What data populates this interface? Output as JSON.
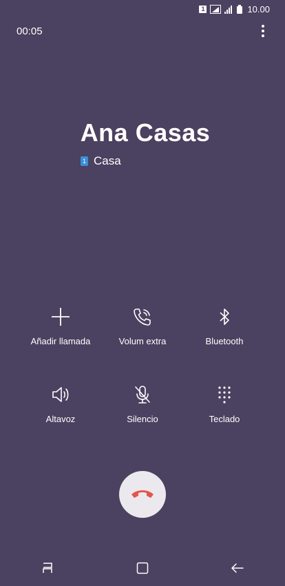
{
  "status_bar": {
    "sim_slot": "1",
    "time": "10.00",
    "icons": [
      "sim-1-icon",
      "signal-icon",
      "signal-icon",
      "battery-icon"
    ]
  },
  "call": {
    "timer": "00:05",
    "contact_name": "Ana Casas",
    "sim_label": "1",
    "number_label": "Casa"
  },
  "actions": [
    {
      "label": "Añadir llamada",
      "icon": "add-icon"
    },
    {
      "label": "Volum extra",
      "icon": "phone-volume-icon"
    },
    {
      "label": "Bluetooth",
      "icon": "bluetooth-icon"
    },
    {
      "label": "Altavoz",
      "icon": "speaker-icon"
    },
    {
      "label": "Silencio",
      "icon": "mic-off-icon"
    },
    {
      "label": "Teclado",
      "icon": "keypad-icon"
    }
  ],
  "end_call": {
    "icon": "end-call-icon",
    "color": "#e2574c"
  },
  "nav": [
    "recent-apps-icon",
    "home-icon",
    "back-icon"
  ],
  "colors": {
    "background": "#4b4160",
    "end_call_bg": "#ece9ee"
  }
}
